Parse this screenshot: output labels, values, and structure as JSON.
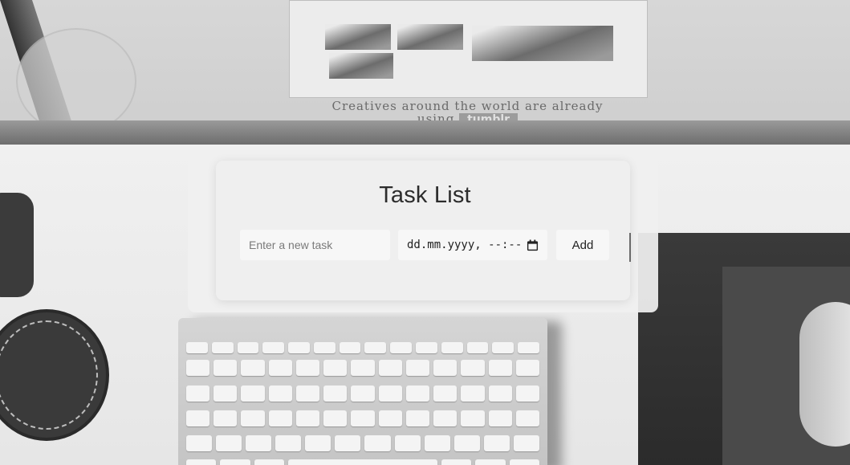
{
  "background": {
    "tagline_text": "Creatives around the world are already using",
    "tagline_badge": "tumblr"
  },
  "task_app": {
    "title": "Task List",
    "task_input": {
      "placeholder": "Enter a new task",
      "value": ""
    },
    "date_input": {
      "display": "dd.mm.yyyy, --:--",
      "icon": "calendar-icon"
    },
    "add_button": {
      "label": "Add"
    }
  },
  "colors": {
    "card_bg": "#efefef",
    "overlay_bg": "#f0f0f0",
    "input_bg": "#f7f7f7",
    "title_text": "#2c2c2c",
    "placeholder_text": "#7a7a7a"
  }
}
